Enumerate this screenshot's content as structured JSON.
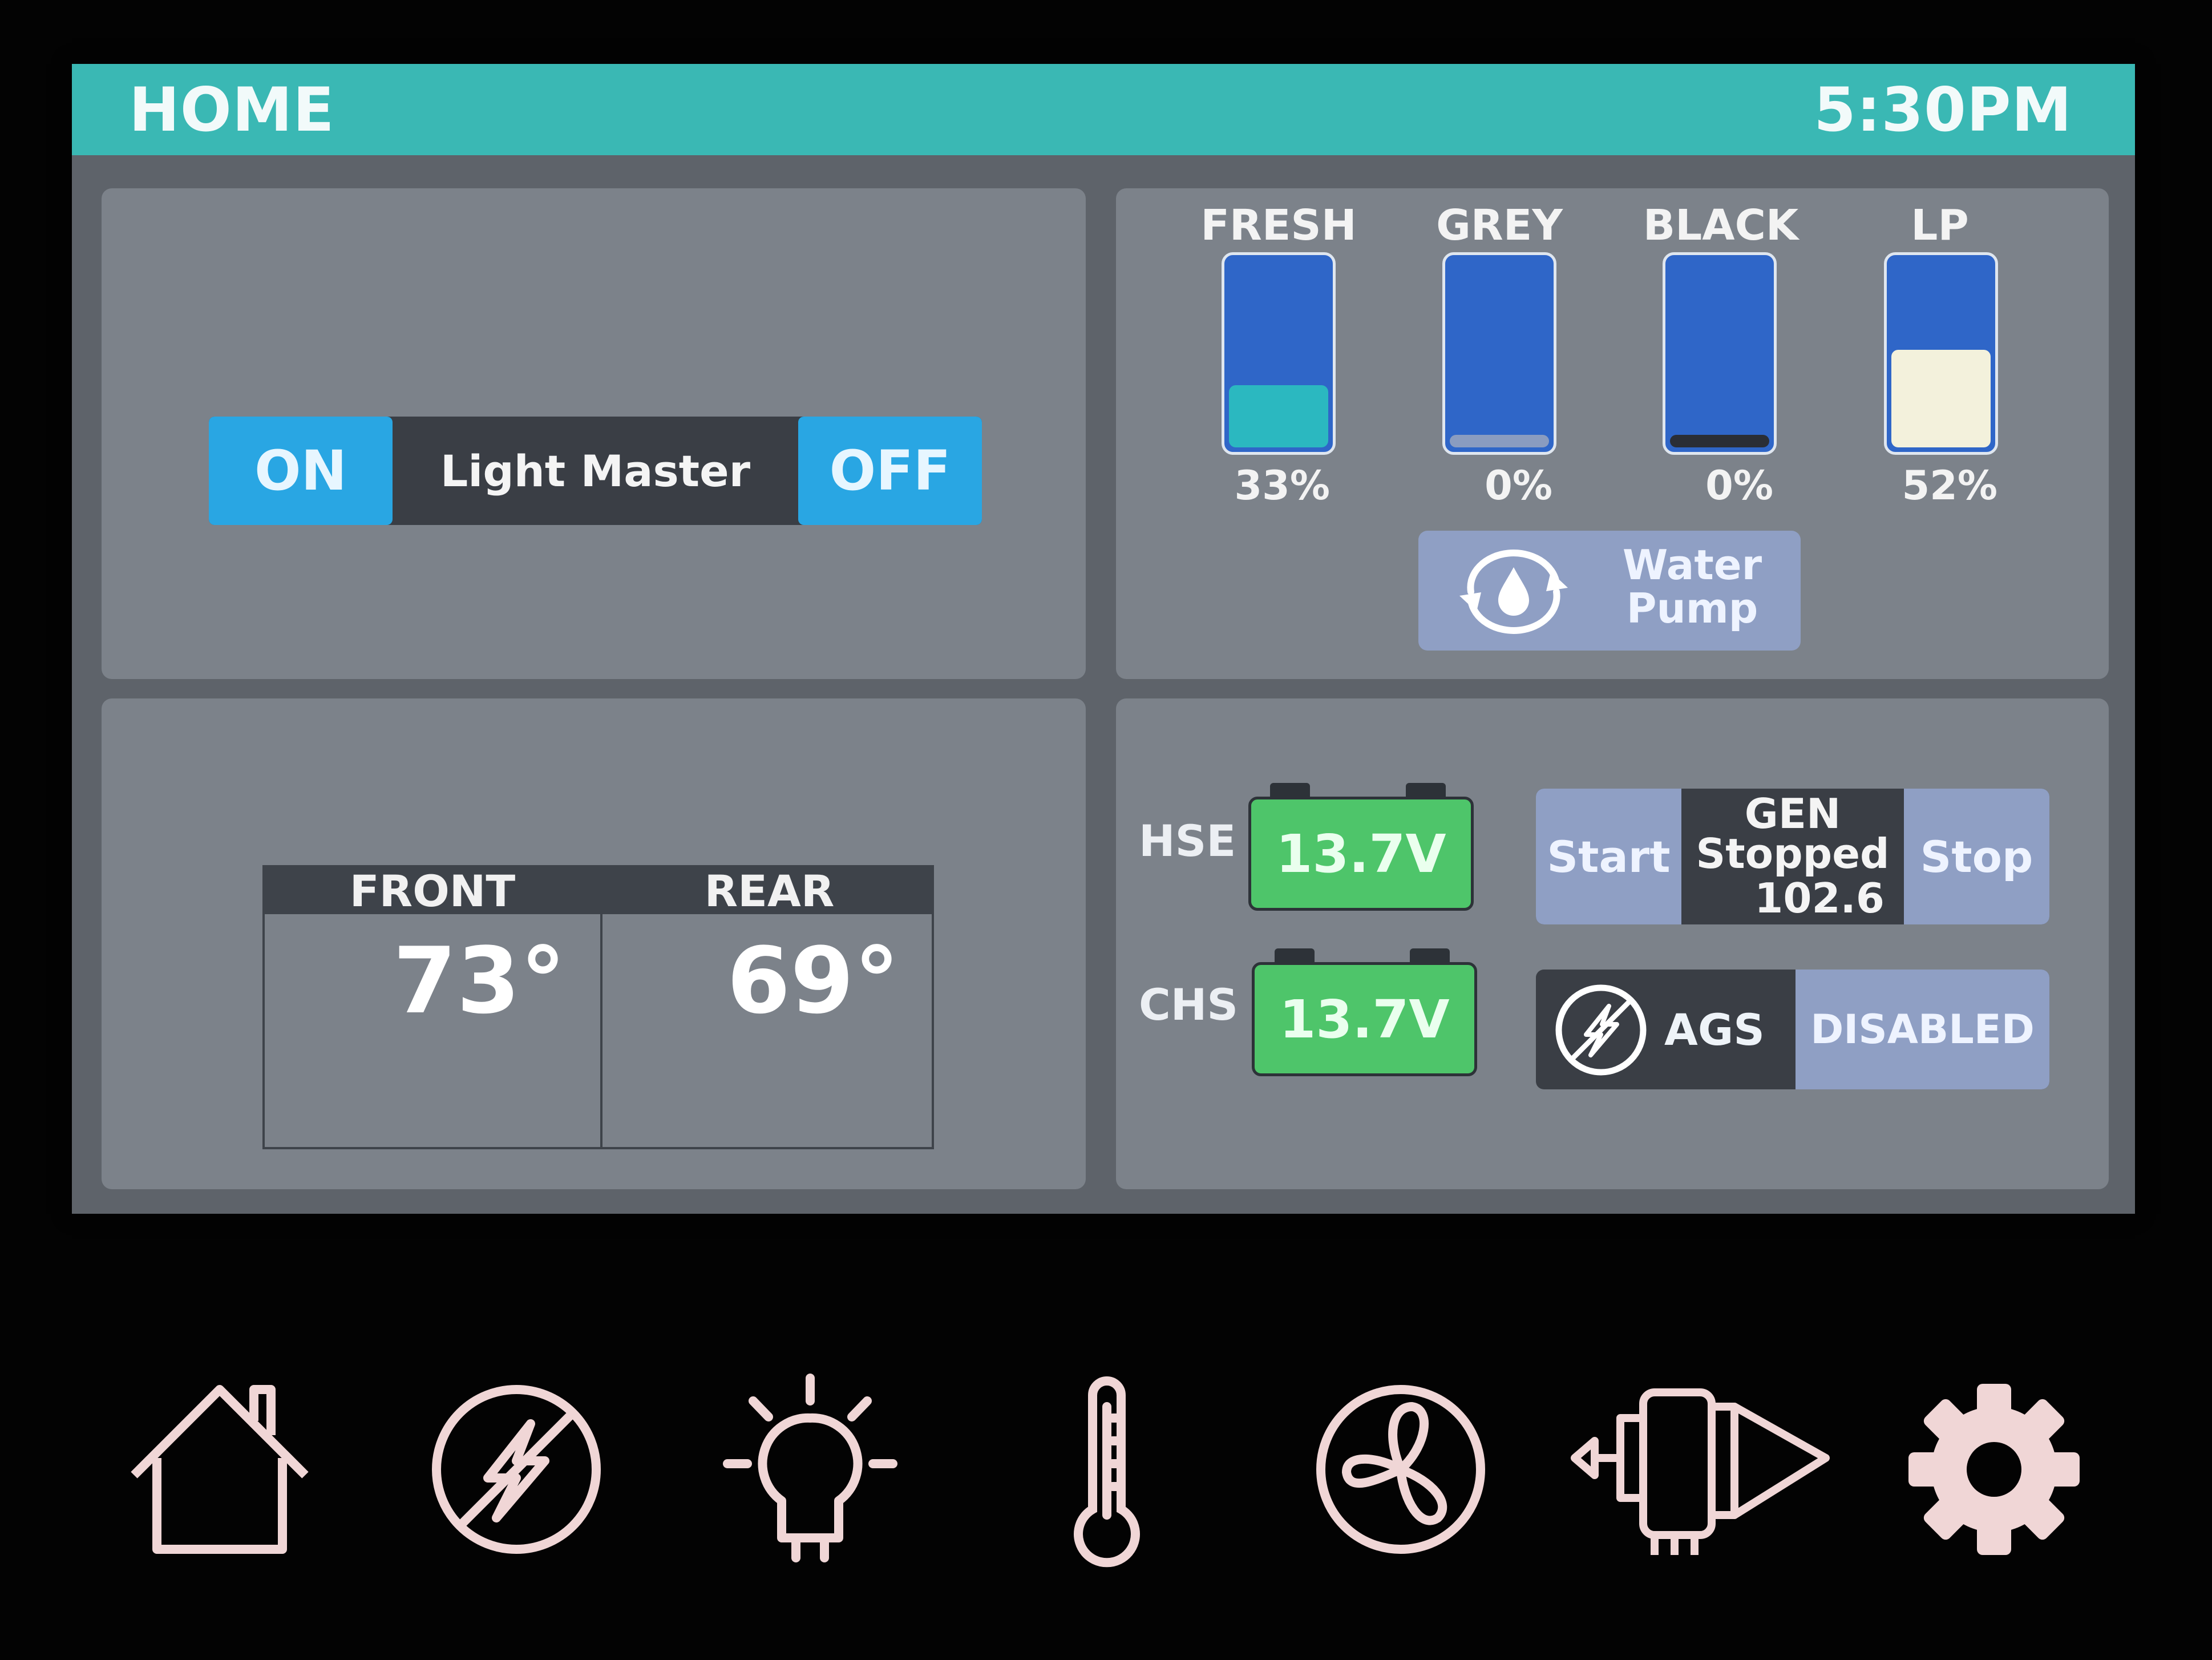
{
  "header": {
    "title": "HOME",
    "time": "5:30PM"
  },
  "light_master": {
    "on_label": "ON",
    "label": "Light Master",
    "off_label": "OFF"
  },
  "tanks": [
    {
      "name": "FRESH",
      "percent_label": "33%",
      "level": 0.33,
      "fill_color": "#2bb8c0"
    },
    {
      "name": "GREY",
      "percent_label": "0%",
      "level": 0.0,
      "fill_color": "#8a9cc0"
    },
    {
      "name": "BLACK",
      "percent_label": "0%",
      "level": 0.0,
      "fill_color": "#2a2e36"
    },
    {
      "name": "LP",
      "percent_label": "52%",
      "level": 0.52,
      "fill_color": "#f3f1dc"
    }
  ],
  "water_pump": {
    "label_line1": "Water",
    "label_line2": "Pump",
    "icon": "water-pump-icon"
  },
  "temperatures": {
    "front": {
      "label": "FRONT",
      "value": "73°"
    },
    "rear": {
      "label": "REAR",
      "value": "69°"
    }
  },
  "batteries": {
    "hse": {
      "label": "HSE",
      "voltage": "13.7V"
    },
    "chs": {
      "label": "CHS",
      "voltage": "13.7V"
    }
  },
  "generator": {
    "start_label": "Start",
    "stop_label": "Stop",
    "title": "GEN",
    "status": "Stopped",
    "hours": "102.6"
  },
  "ags": {
    "label": "AGS",
    "status": "DISABLED",
    "icon": "lightning-circle-icon"
  },
  "nav": [
    {
      "name": "home",
      "icon": "home-icon"
    },
    {
      "name": "power",
      "icon": "power-lightning-icon"
    },
    {
      "name": "lights",
      "icon": "light-bulb-icon"
    },
    {
      "name": "climate",
      "icon": "thermometer-icon"
    },
    {
      "name": "fan",
      "icon": "fan-icon"
    },
    {
      "name": "slides",
      "icon": "slide-out-icon"
    },
    {
      "name": "settings",
      "icon": "gear-icon"
    }
  ],
  "colors": {
    "title_bar": "#3ab8b4",
    "button_blue": "#29a6e3",
    "button_lavender": "#8f9fc4",
    "battery_green": "#4ec56a",
    "tank_blue": "#2f66c8",
    "nav_icon": "#f0d6d6"
  }
}
